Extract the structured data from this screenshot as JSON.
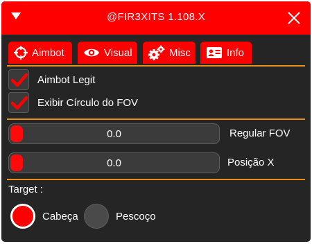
{
  "window": {
    "title": "@FIR3XITS 1.108.X"
  },
  "colors": {
    "accent": "#ff0000",
    "separator": "#e8911a",
    "panel": "#252525",
    "control": "#3b3b3b"
  },
  "tabs": [
    {
      "label": "Aimbot",
      "icon": "crosshair-icon"
    },
    {
      "label": "Visual",
      "icon": "eye-icon"
    },
    {
      "label": "Misc",
      "icon": "gears-icon"
    },
    {
      "label": "Info",
      "icon": "id-card-icon"
    }
  ],
  "checkboxes": [
    {
      "label": "Aimbot Legit",
      "checked": true
    },
    {
      "label": "Exibir Círculo do FOV",
      "checked": true
    }
  ],
  "sliders": [
    {
      "label": "Regular FOV",
      "value": "0.0"
    },
    {
      "label": "Posição X",
      "value": "0.0"
    }
  ],
  "target": {
    "label": "Target :",
    "options": [
      {
        "label": "Cabeça",
        "selected": true
      },
      {
        "label": "Pescoço",
        "selected": false
      }
    ]
  }
}
